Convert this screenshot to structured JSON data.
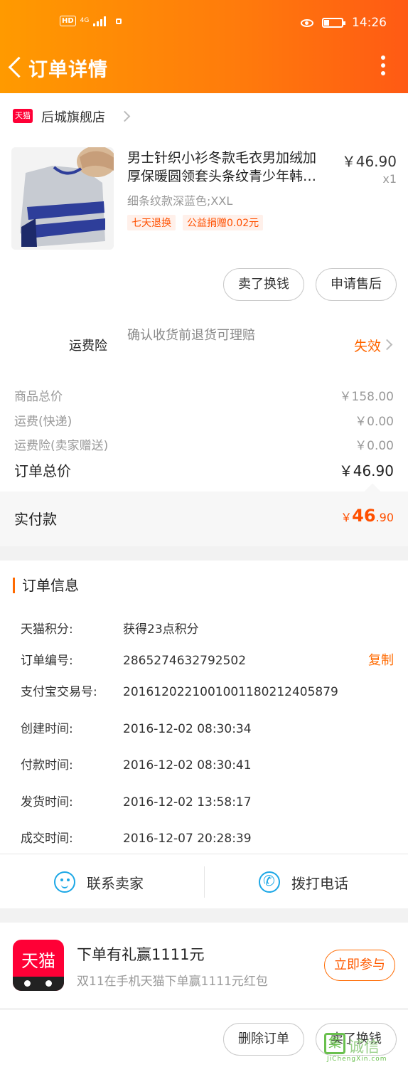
{
  "status_bar": {
    "network": "HD",
    "signal": "4G",
    "time": "14:26"
  },
  "header": {
    "title": "订单详情"
  },
  "shop": {
    "badge": "天猫",
    "name": "后城旗舰店"
  },
  "product": {
    "name_line1": "男士针织小衫冬款毛衣男加绒加",
    "name_line2": "厚保暖圆领套头条纹青少年韩…",
    "price": "￥46.90",
    "qty": "x1",
    "sku": "细条纹款深蓝色;XXL",
    "tags": [
      "七天退换",
      "公益捐赠0.02元"
    ]
  },
  "product_actions": {
    "sell_label": "卖了换钱",
    "after_sale_label": "申请售后"
  },
  "shipping_insurance": {
    "label": "运费险",
    "desc": "确认收货前退货可理赔",
    "status": "失效"
  },
  "price_summary": {
    "rows": [
      {
        "label": "商品总价",
        "value": "￥158.00"
      },
      {
        "label": "运费(快递)",
        "value": "￥0.00"
      },
      {
        "label": "运费险(卖家赠送)",
        "value": "￥0.00"
      }
    ],
    "total_label": "订单总价",
    "total_value": "￥46.90",
    "paid_label": "实付款",
    "paid_currency": "￥",
    "paid_int": "46",
    "paid_dec": ".90"
  },
  "order_info": {
    "title": "订单信息",
    "rows": [
      {
        "label": "天猫积分:",
        "value": "获得23点积分"
      },
      {
        "label": "订单编号:",
        "value": "2865274632792502"
      },
      {
        "label": "支付宝交易号:",
        "value": "2016120221001001180212405879"
      },
      {
        "label": "创建时间:",
        "value": "2016-12-02 08:30:34"
      },
      {
        "label": "付款时间:",
        "value": "2016-12-02 08:30:41"
      },
      {
        "label": "发货时间:",
        "value": "2016-12-02 13:58:17"
      },
      {
        "label": "成交时间:",
        "value": "2016-12-07 20:28:39"
      }
    ],
    "copy_label": "复制",
    "contact_label": "联系卖家",
    "call_label": "拨打电话"
  },
  "promo": {
    "logo_text": "天猫",
    "title": "下单有礼赢1111元",
    "subtitle": "双11在手机天猫下单赢1111元红包",
    "button": "立即参与"
  },
  "bottom_bar": {
    "delete_label": "删除订单",
    "sell_label": "卖了换钱"
  },
  "watermark": {
    "char": "集",
    "text": "诚信",
    "url": "JiChengXin.com"
  },
  "colors": {
    "accent": "#ff6a00",
    "price_red": "#ff5000",
    "tmall_red": "#ff0036",
    "icon_blue": "#1ba7e6"
  }
}
